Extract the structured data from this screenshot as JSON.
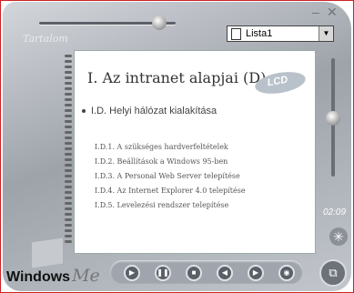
{
  "player": {
    "window_controls": {
      "minimize": "–",
      "close": "✕"
    },
    "seek_label": "Tartalom",
    "playlist": {
      "selected": "Lista1",
      "arrow": "▼"
    },
    "time": "02:09",
    "brand": {
      "windows": "Windows",
      "me": "Me"
    },
    "controls": {
      "play": "▶",
      "pause": "❚❚",
      "stop": "■",
      "previous": "◀",
      "next": "▶",
      "mute": "◉"
    },
    "effects_glyph": "✳",
    "skin_glyph": "⧉"
  },
  "slide": {
    "title": "I. Az intranet alapjai (D)",
    "logo_text": "LCD",
    "bullet": "I.D. Helyi hálózat kialakítása",
    "items": [
      "I.D.1. A szükséges hardverfeltételek",
      "I.D.2. Beállítások a Windows 95-ben",
      "I.D.3. A Personal Web Server telepítése",
      "I.D.4. Az Internet Explorer 4.0 telepítése",
      "I.D.5. Levelezési rendszer telepítése"
    ]
  },
  "colors": {
    "frame_border": "#cc2222",
    "chrome": "#a0a5ad"
  }
}
